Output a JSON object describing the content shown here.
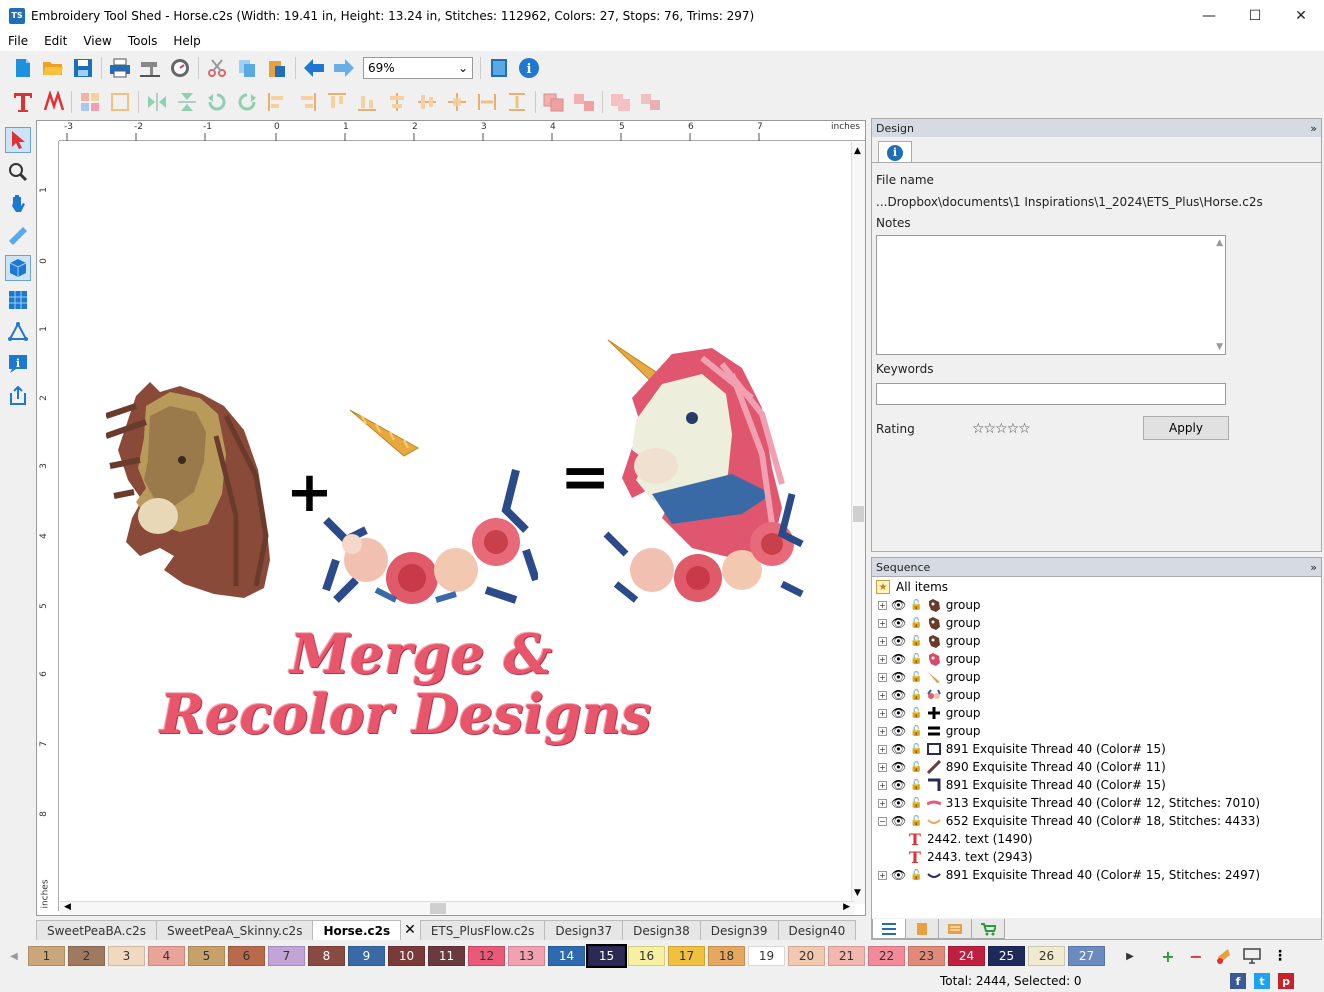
{
  "window": {
    "title": "Embroidery Tool Shed - Horse.c2s (Width: 19.41 in, Height: 13.24 in, Stitches: 112962, Colors: 27, Stops: 76, Trims: 297)",
    "app_badge": "TS",
    "minimize": "—",
    "maximize": "☐",
    "close": "✕"
  },
  "menu": [
    "File",
    "Edit",
    "View",
    "Tools",
    "Help"
  ],
  "toolbar": {
    "zoom_value": "69%"
  },
  "ruler": {
    "top_labels": [
      "-3",
      "-2",
      "-1",
      "0",
      "1",
      "2",
      "3",
      "4",
      "5",
      "6",
      "7"
    ],
    "left_labels": [
      "1",
      "0",
      "1",
      "2",
      "3",
      "4",
      "5",
      "6",
      "7",
      "8"
    ],
    "unit": "inches"
  },
  "canvas": {
    "headline_line1": "Merge &",
    "headline_line2": "Recolor Designs",
    "plus_symbol": "+",
    "equals_symbol": "="
  },
  "doc_tabs": [
    {
      "label": "SweetPeaBA.c2s",
      "active": false
    },
    {
      "label": "SweetPeaA_Skinny.c2s",
      "active": false
    },
    {
      "label": "Horse.c2s",
      "active": true
    },
    {
      "label": "ETS_PlusFlow.c2s",
      "active": false
    },
    {
      "label": "Design37",
      "active": false
    },
    {
      "label": "Design38",
      "active": false
    },
    {
      "label": "Design39",
      "active": false
    },
    {
      "label": "Design40",
      "active": false
    }
  ],
  "palette": [
    {
      "n": "1",
      "color": "#c9a77a"
    },
    {
      "n": "2",
      "color": "#a07a60"
    },
    {
      "n": "3",
      "color": "#f1d9c0"
    },
    {
      "n": "4",
      "color": "#e8a498"
    },
    {
      "n": "5",
      "color": "#c8a06a"
    },
    {
      "n": "6",
      "color": "#b86a4a"
    },
    {
      "n": "7",
      "color": "#c2a4d6"
    },
    {
      "n": "8",
      "color": "#8a4a44"
    },
    {
      "n": "9",
      "color": "#3a6aa6"
    },
    {
      "n": "10",
      "color": "#7a3a3a"
    },
    {
      "n": "11",
      "color": "#6a3a3e"
    },
    {
      "n": "12",
      "color": "#e85a78"
    },
    {
      "n": "13",
      "color": "#f0a2b0"
    },
    {
      "n": "14",
      "color": "#2f6ab0"
    },
    {
      "n": "15",
      "color": "#2a2a54"
    },
    {
      "n": "16",
      "color": "#f6f0a0"
    },
    {
      "n": "17",
      "color": "#f0c040"
    },
    {
      "n": "18",
      "color": "#e6a860"
    },
    {
      "n": "19",
      "color": "#ffffff"
    },
    {
      "n": "20",
      "color": "#f2c8b0"
    },
    {
      "n": "21",
      "color": "#f2b8b0"
    },
    {
      "n": "22",
      "color": "#f28a9a"
    },
    {
      "n": "23",
      "color": "#e08a7a"
    },
    {
      "n": "24",
      "color": "#c02040"
    },
    {
      "n": "25",
      "color": "#1e2a5a"
    },
    {
      "n": "26",
      "color": "#f0ead0"
    },
    {
      "n": "27",
      "color": "#6a8ac0"
    }
  ],
  "status": {
    "text": "Total: 2444, Selected: 0"
  },
  "design_panel": {
    "title": "Design",
    "collapse": "»",
    "file_name_label": "File name",
    "file_name_value": "...Dropbox\\documents\\1 Inspirations\\1_2024\\ETS_Plus\\Horse.c2s",
    "notes_label": "Notes",
    "keywords_label": "Keywords",
    "rating_label": "Rating",
    "rating_stars": "☆☆☆☆☆",
    "apply_label": "Apply"
  },
  "sequence_panel": {
    "title": "Sequence",
    "collapse": "»",
    "root_label": "All items",
    "items": [
      {
        "label": "group",
        "thumb": "#6a3a2a",
        "indent": 0,
        "expander": "+",
        "kind": "horse"
      },
      {
        "label": "group",
        "thumb": "#6a3a2a",
        "indent": 0,
        "expander": "+",
        "kind": "horse"
      },
      {
        "label": "group",
        "thumb": "#6a3a2a",
        "indent": 0,
        "expander": "+",
        "kind": "horse"
      },
      {
        "label": "group",
        "thumb": "#d84a6a",
        "indent": 0,
        "expander": "+",
        "kind": "unicorn"
      },
      {
        "label": "group",
        "thumb": "#e0a040",
        "indent": 0,
        "expander": "+",
        "kind": "horn"
      },
      {
        "label": "group",
        "thumb": "#3a5a9a",
        "indent": 0,
        "expander": "+",
        "kind": "flowers"
      },
      {
        "label": "group",
        "thumb": "#000000",
        "indent": 0,
        "expander": "+",
        "kind": "plus"
      },
      {
        "label": "group",
        "thumb": "#000000",
        "indent": 0,
        "expander": "+",
        "kind": "equals"
      },
      {
        "label": "891 Exquisite Thread 40 (Color# 15)",
        "thumb": "#2a2a54",
        "indent": 0,
        "expander": "+",
        "kind": "frame"
      },
      {
        "label": "890 Exquisite Thread 40 (Color# 11)",
        "thumb": "#6a3a3e",
        "indent": 0,
        "expander": "+",
        "kind": "slash"
      },
      {
        "label": "891 Exquisite Thread 40 (Color# 15)",
        "thumb": "#2a2a54",
        "indent": 0,
        "expander": "+",
        "kind": "corner"
      },
      {
        "label": "313 Exquisite Thread 40 (Color# 12, Stitches: 7010)",
        "thumb": "#e85a78",
        "indent": 0,
        "expander": "+",
        "kind": "line"
      },
      {
        "label": "652 Exquisite Thread 40 (Color# 18, Stitches: 4433)",
        "thumb": "#e6a860",
        "indent": 0,
        "expander": "−",
        "kind": "curve"
      },
      {
        "label": "2442. text (1490)",
        "thumb": "#d33",
        "indent": 1,
        "expander": "",
        "kind": "text"
      },
      {
        "label": "2443. text (2943)",
        "thumb": "#d33",
        "indent": 1,
        "expander": "",
        "kind": "text"
      },
      {
        "label": "891 Exquisite Thread 40 (Color# 15, Stitches: 2497)",
        "thumb": "#2a2a54",
        "indent": 0,
        "expander": "+",
        "kind": "curve"
      }
    ]
  }
}
